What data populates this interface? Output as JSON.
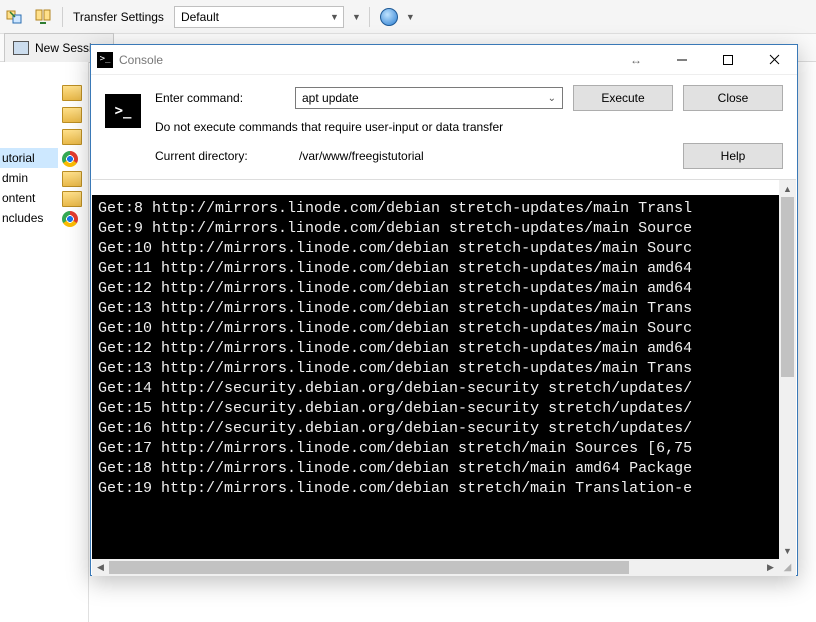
{
  "toolbar": {
    "transfer_label": "Transfer Settings",
    "transfer_value": "Default"
  },
  "sessionbar": {
    "new_session_label": "New Session"
  },
  "left_items": [
    "utorial",
    "dmin",
    "ontent",
    "ncludes"
  ],
  "console": {
    "title": "Console",
    "enter_command_label": "Enter command:",
    "command_value": "apt update",
    "hint": "Do not execute commands that require user-input or data transfer",
    "current_dir_label": "Current directory:",
    "current_dir_value": "/var/www/freegistutorial",
    "buttons": {
      "execute": "Execute",
      "close": "Close",
      "help": "Help"
    },
    "output": [
      "Get:8 http://mirrors.linode.com/debian stretch-updates/main Transl",
      "Get:9 http://mirrors.linode.com/debian stretch-updates/main Source",
      "Get:10 http://mirrors.linode.com/debian stretch-updates/main Sourc",
      "Get:11 http://mirrors.linode.com/debian stretch-updates/main amd64",
      "Get:12 http://mirrors.linode.com/debian stretch-updates/main amd64",
      "Get:13 http://mirrors.linode.com/debian stretch-updates/main Trans",
      "Get:10 http://mirrors.linode.com/debian stretch-updates/main Sourc",
      "Get:12 http://mirrors.linode.com/debian stretch-updates/main amd64",
      "Get:13 http://mirrors.linode.com/debian stretch-updates/main Trans",
      "Get:14 http://security.debian.org/debian-security stretch/updates/",
      "Get:15 http://security.debian.org/debian-security stretch/updates/",
      "Get:16 http://security.debian.org/debian-security stretch/updates/",
      "Get:17 http://mirrors.linode.com/debian stretch/main Sources [6,75",
      "Get:18 http://mirrors.linode.com/debian stretch/main amd64 Package",
      "Get:19 http://mirrors.linode.com/debian stretch/main Translation-e"
    ]
  }
}
